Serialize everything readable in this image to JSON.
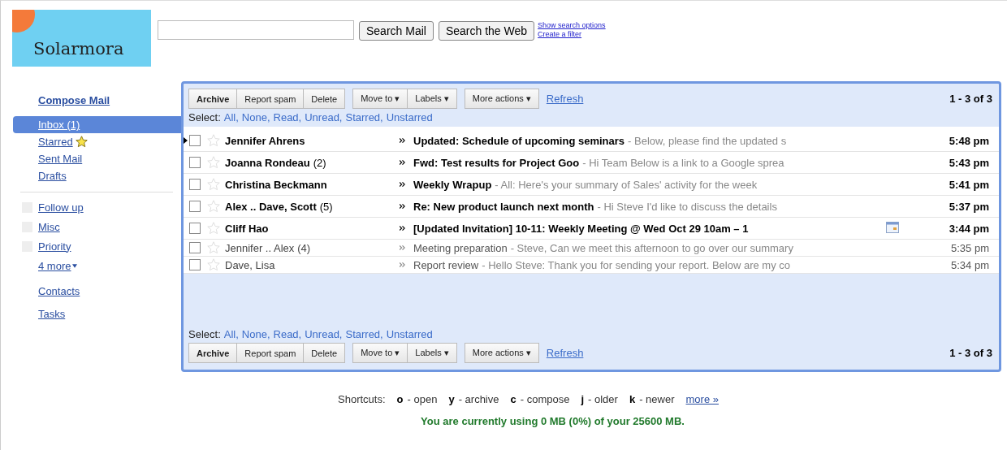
{
  "logo": {
    "text": "Solarmora"
  },
  "search": {
    "buttons": [
      "Search Mail",
      "Search the Web"
    ],
    "links": [
      "Show search options",
      "Create a filter"
    ]
  },
  "sidebar": {
    "compose": "Compose Mail",
    "items": [
      {
        "label": "Inbox (1)",
        "selected": true,
        "kind": "folder"
      },
      {
        "label": "Starred",
        "selected": false,
        "kind": "starred"
      },
      {
        "label": "Sent Mail",
        "selected": false,
        "kind": "folder"
      },
      {
        "label": "Drafts",
        "selected": false,
        "kind": "folder"
      }
    ],
    "labels": [
      "Follow up",
      "Misc",
      "Priority"
    ],
    "more": "4 more",
    "links": [
      "Contacts",
      "Tasks"
    ]
  },
  "top_toolbar": {
    "groups": [
      [
        {
          "label": "Archive",
          "bold": true
        },
        {
          "label": "Report spam",
          "bold": false
        },
        {
          "label": "Delete",
          "bold": false
        }
      ],
      [
        {
          "label": "Move to ▾",
          "bold": false
        },
        {
          "label": "Labels ▾",
          "bold": false
        }
      ],
      [
        {
          "label": "More actions ▾",
          "bold": false
        }
      ]
    ],
    "refresh": "Refresh",
    "count": "1 - 3 of 3",
    "select_label": "Select:",
    "select_options": [
      "All,",
      "None,",
      "Read,",
      "Unread,",
      "Starred,",
      "Unstarred"
    ]
  },
  "messages": [
    {
      "sender": "Jennifer Ahrens",
      "subject": "Updated: Schedule of upcoming seminars",
      "snippet": "- Below, please find the updated s",
      "time": "5:48 pm",
      "unread": true,
      "current": true,
      "checked": false,
      "starred": false,
      "calendar": false
    },
    {
      "sender": "Joanna Rondeau",
      "count": "(2)",
      "subject": "Fwd: Test results for Project Goo",
      "snippet": "- Hi Team Below is a link to a Google sprea",
      "time": "5:43 pm",
      "unread": true,
      "current": false,
      "checked": false,
      "starred": false,
      "calendar": false
    },
    {
      "sender": "Christina Beckmann",
      "subject": "Weekly Wrapup",
      "snippet": "- All: Here's your summary of Sales' activity for the week",
      "time": "5:41 pm",
      "unread": true,
      "current": false,
      "checked": false,
      "starred": false,
      "calendar": false
    },
    {
      "sender": "Alex .. Dave, Scott",
      "count": "(5)",
      "subject": "Re: New product launch next month",
      "snippet": "- Hi Steve I'd like to discuss the details",
      "time": "5:37 pm",
      "unread": true,
      "current": false,
      "checked": false,
      "starred": false,
      "calendar": false
    },
    {
      "sender": "Cliff Hao",
      "subject": "[Updated Invitation] 10-11: Weekly Meeting @ Wed Oct 29 10am – 1",
      "time": "3:44 pm",
      "unread": true,
      "current": false,
      "checked": false,
      "starred": false,
      "calendar": true
    },
    {
      "sender": "Jennifer .. Alex",
      "count": "(4)",
      "subject": "Meeting preparation",
      "snippet": "- Steve, Can we meet this afternoon to go over our summary",
      "time": "5:35 pm",
      "unread": false,
      "current": false,
      "checked": false,
      "starred": false,
      "calendar": false
    },
    {
      "sender": "Dave, Lisa",
      "subject": "Report review",
      "snippet": "- Hello Steve: Thank you for sending your report. Below are my co",
      "time": "5:34 pm",
      "unread": false,
      "current": false,
      "checked": false,
      "starred": false,
      "calendar": false
    }
  ],
  "bottom_toolbar": {
    "select_label": "Select:",
    "select_options": [
      "All,",
      "None,",
      "Read,",
      "Unread,",
      "Starred,",
      "Unstarred"
    ],
    "groups": [
      [
        {
          "label": "Archive",
          "bold": true
        },
        {
          "label": "Report spam",
          "bold": false
        },
        {
          "label": "Delete",
          "bold": false
        }
      ],
      [
        {
          "label": "Move to ▾",
          "bold": false
        },
        {
          "label": "Labels ▾",
          "bold": false
        }
      ],
      [
        {
          "label": "More actions ▾",
          "bold": false
        }
      ]
    ],
    "refresh": "Refresh",
    "count": "1 - 3 of 3"
  },
  "shortcuts": {
    "label": "Shortcuts:",
    "items": [
      {
        "key": "o",
        "action": "- open"
      },
      {
        "key": "y",
        "action": "- archive"
      },
      {
        "key": "c",
        "action": "- compose"
      },
      {
        "key": "j",
        "action": "- older"
      },
      {
        "key": "k",
        "action": "- newer"
      }
    ],
    "more": "more »"
  },
  "usage": "You are currently using 0 MB (0%) of your 25600 MB."
}
